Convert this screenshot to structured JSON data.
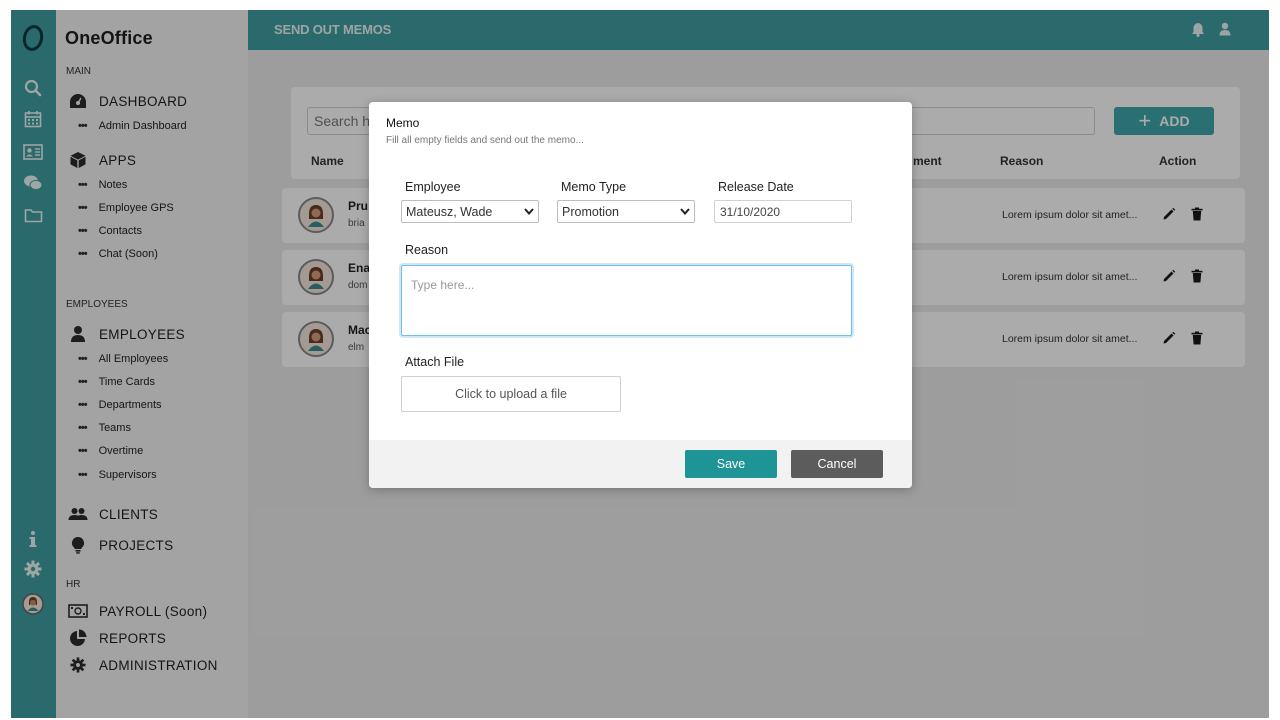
{
  "app": {
    "name": "OneOffice"
  },
  "topbar": {
    "title": "SEND OUT MEMOS"
  },
  "sidebar": {
    "sections": {
      "main": "MAIN",
      "employees": "EMPLOYEES",
      "hr": "HR"
    },
    "dashboard": {
      "label": "DASHBOARD",
      "subs": [
        "Admin Dashboard"
      ]
    },
    "apps": {
      "label": "APPS",
      "subs": [
        "Notes",
        "Employee GPS",
        "Contacts",
        "Chat (Soon)"
      ]
    },
    "employees": {
      "label": "EMPLOYEES",
      "subs": [
        "All Employees",
        "Time Cards",
        "Departments",
        "Teams",
        "Overtime",
        "Supervisors"
      ]
    },
    "clients": "CLIENTS",
    "projects": "PROJECTS",
    "payroll": "PAYROLL (Soon)",
    "reports": "REPORTS",
    "administration": "ADMINISTRATION"
  },
  "main": {
    "search_placeholder": "Search h",
    "add_label": "ADD",
    "columns": {
      "name": "Name",
      "ment": "ment",
      "reason": "Reason",
      "action": "Action"
    },
    "rows": [
      {
        "name": "Pru",
        "email": "bria",
        "reason": "Lorem ipsum dolor sit amet..."
      },
      {
        "name": "Ena",
        "email": "dom",
        "reason": "Lorem ipsum dolor sit amet..."
      },
      {
        "name": "Mac",
        "email": "elm",
        "reason": "Lorem ipsum dolor sit amet..."
      }
    ]
  },
  "modal": {
    "title": "Memo",
    "subtitle": "Fill all empty fields and send out the memo...",
    "employee_label": "Employee",
    "employee_value": "Mateusz, Wade",
    "memo_type_label": "Memo Type",
    "memo_type_value": "Promotion",
    "release_date_label": "Release Date",
    "release_date_value": "31/10/2020",
    "reason_label": "Reason",
    "reason_placeholder": "Type here...",
    "attach_label": "Attach File",
    "upload_text": "Click to upload a file",
    "save_label": "Save",
    "cancel_label": "Cancel"
  },
  "colors": {
    "accent": "#3f9fa3",
    "save": "#1f9497",
    "cancel": "#5c5c5c"
  }
}
